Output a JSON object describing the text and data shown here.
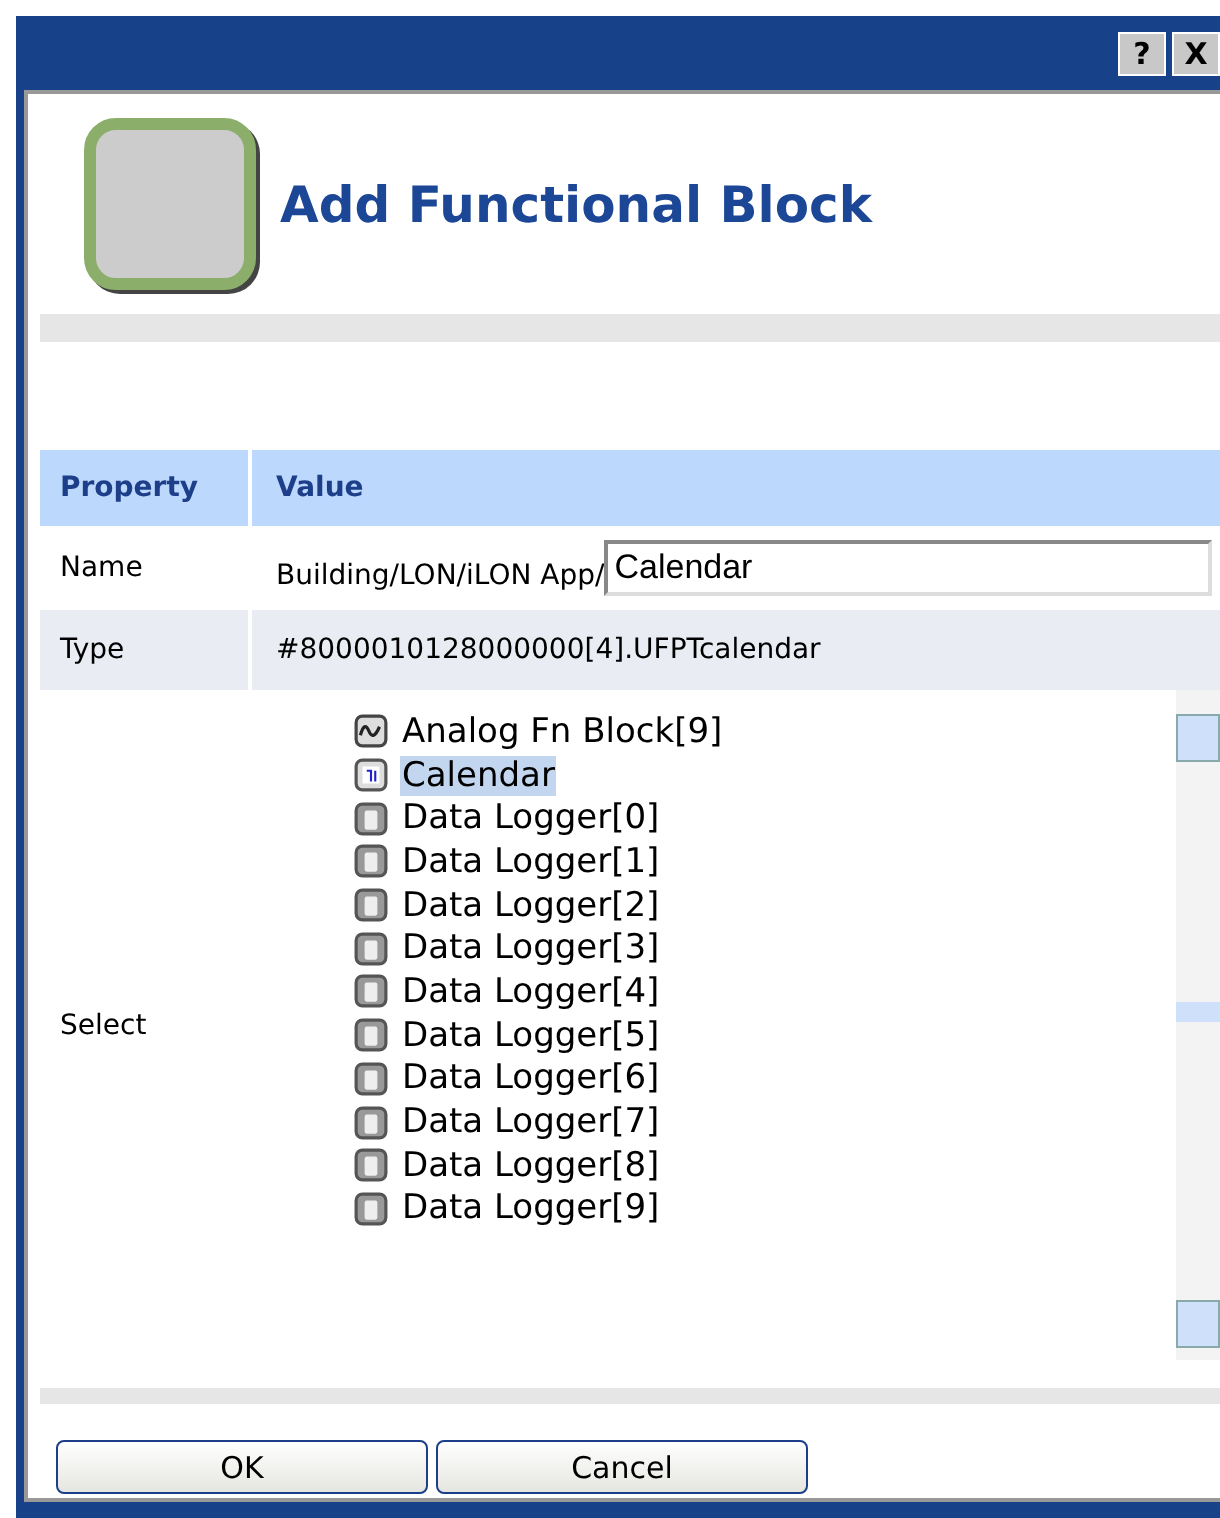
{
  "window": {
    "help_button": "?",
    "close_button": "X"
  },
  "title": "Add Functional Block",
  "table": {
    "columns": [
      "Property",
      "Value"
    ],
    "name_row": {
      "label": "Name",
      "prefix": "Building/LON/iLON App/",
      "value": "Calendar"
    },
    "type_row": {
      "label": "Type",
      "value": "#8000010128000000[4].UFPTcalendar"
    },
    "select_row": {
      "label": "Select",
      "items": [
        {
          "label": "Analog Fn Block[9]",
          "kind": "analog",
          "selected": false
        },
        {
          "label": "Calendar",
          "kind": "calendar",
          "selected": true
        },
        {
          "label": "Data Logger[0]",
          "kind": "logger",
          "selected": false
        },
        {
          "label": "Data Logger[1]",
          "kind": "logger",
          "selected": false
        },
        {
          "label": "Data Logger[2]",
          "kind": "logger",
          "selected": false
        },
        {
          "label": "Data Logger[3]",
          "kind": "logger",
          "selected": false
        },
        {
          "label": "Data Logger[4]",
          "kind": "logger",
          "selected": false
        },
        {
          "label": "Data Logger[5]",
          "kind": "logger",
          "selected": false
        },
        {
          "label": "Data Logger[6]",
          "kind": "logger",
          "selected": false
        },
        {
          "label": "Data Logger[7]",
          "kind": "logger",
          "selected": false
        },
        {
          "label": "Data Logger[8]",
          "kind": "logger",
          "selected": false
        },
        {
          "label": "Data Logger[9]",
          "kind": "logger",
          "selected": false
        }
      ]
    }
  },
  "buttons": [
    "OK",
    "Cancel"
  ]
}
